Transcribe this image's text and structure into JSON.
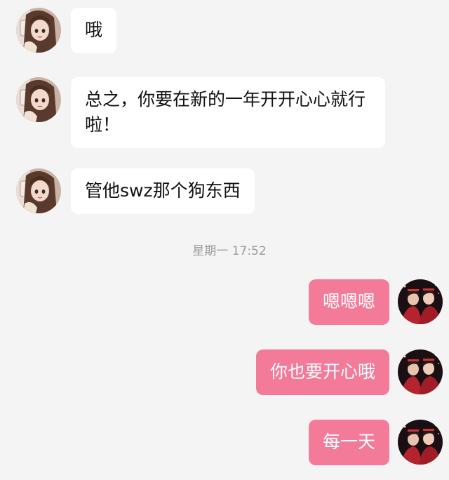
{
  "colors": {
    "background": "#f4f4f4",
    "incoming_bubble": "#ffffff",
    "outgoing_bubble": "#f47a99",
    "timestamp_text": "#9a9a9a"
  },
  "messages_before": [
    {
      "sender": "contact",
      "text": "哦"
    },
    {
      "sender": "contact",
      "text": "总之，你要在新的一年开开心心就行啦！"
    },
    {
      "sender": "contact",
      "text": "管他swz那个狗东西"
    }
  ],
  "timestamp": "星期一 17:52",
  "messages_after": [
    {
      "sender": "me",
      "text": "嗯嗯嗯"
    },
    {
      "sender": "me",
      "text": "你也要开心哦"
    },
    {
      "sender": "me",
      "text": "每一天"
    }
  ]
}
